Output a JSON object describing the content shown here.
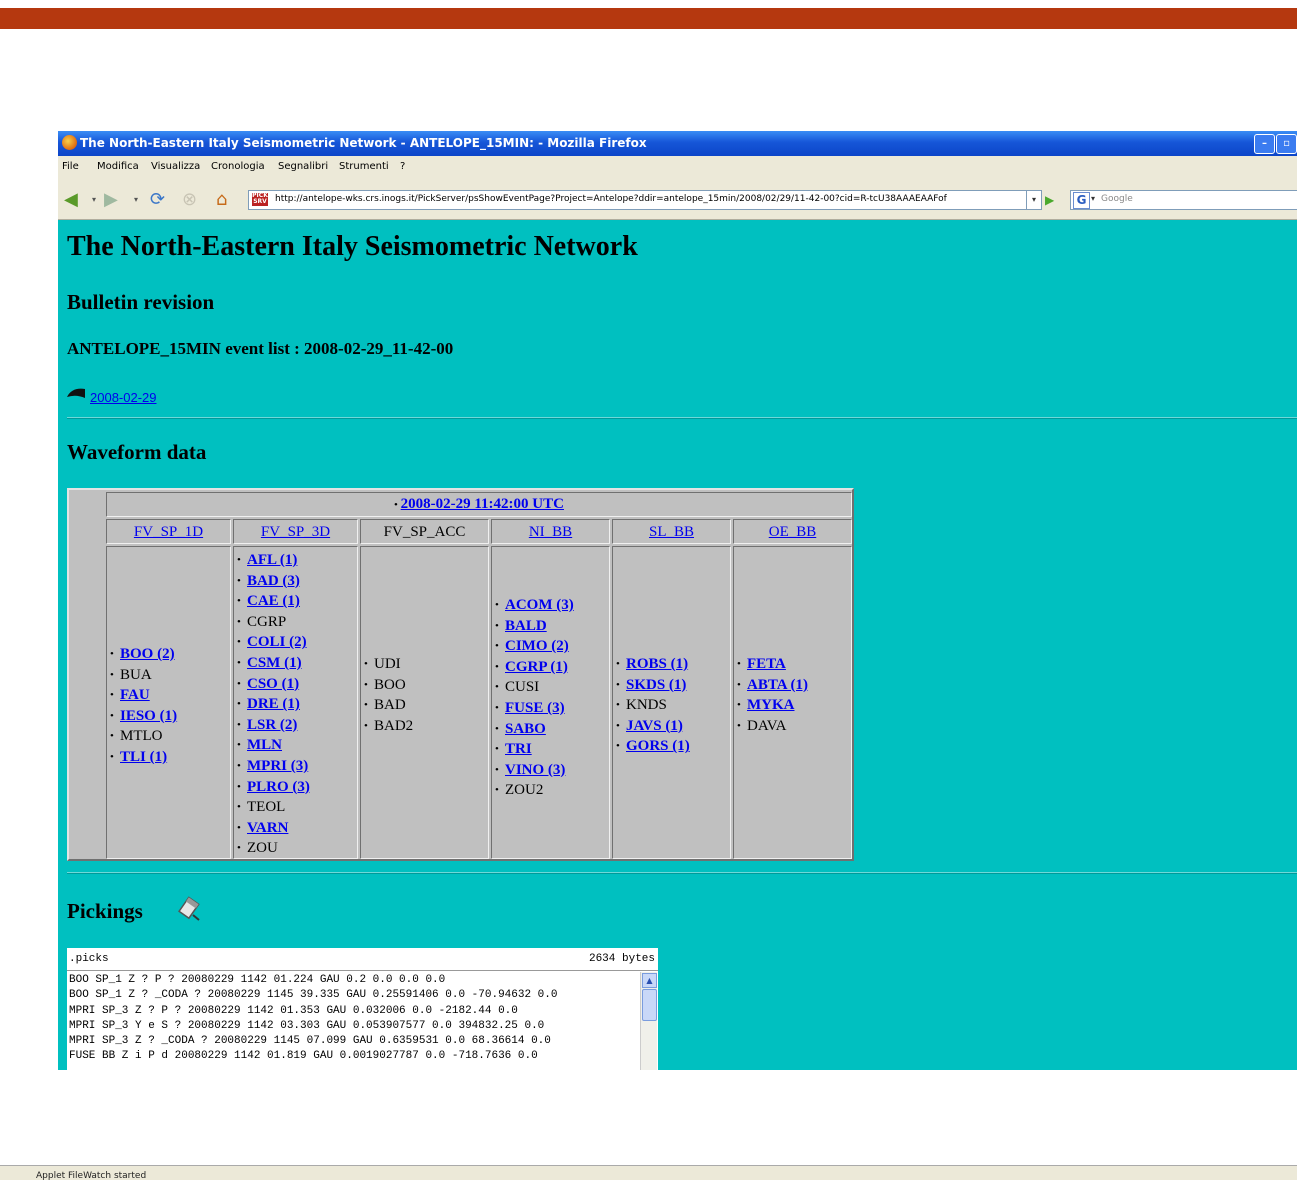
{
  "window": {
    "title": "The North-Eastern Italy Seismometric Network - ANTELOPE_15MIN: - Mozilla Firefox",
    "minimize": "–",
    "maximize": "▫"
  },
  "menu": [
    "File",
    "Modifica",
    "Visualizza",
    "Cronologia",
    "Segnalibri",
    "Strumenti",
    "?"
  ],
  "toolbar": {
    "url": "http://antelope-wks.crs.inogs.it/PickServer/psShowEventPage?Project=Antelope?ddir=antelope_15min/2008/02/29/11-42-00?cid=R-tcU38AAAEAAFof",
    "search_placeholder": "Google"
  },
  "page": {
    "title": "The North-Eastern Italy Seismometric Network",
    "subtitle": "Bulletin revision",
    "event_list": "ANTELOPE_15MIN event list : 2008-02-29_11-42-00",
    "back_link": "2008-02-29",
    "waveform_heading": "Waveform data",
    "pickings_heading": "Pickings"
  },
  "waveform": {
    "timestamp": "2008-02-29 11:42:00 UTC",
    "columns": [
      {
        "name": "FV_SP_1D",
        "link": true,
        "stations": [
          {
            "label": "BOO (2)",
            "link": true
          },
          {
            "label": "BUA",
            "link": false
          },
          {
            "label": "FAU",
            "link": true
          },
          {
            "label": "IESO (1)",
            "link": true
          },
          {
            "label": "MTLO",
            "link": false
          },
          {
            "label": "TLI (1)",
            "link": true
          }
        ]
      },
      {
        "name": "FV_SP_3D",
        "link": true,
        "stations": [
          {
            "label": "AFL (1)",
            "link": true
          },
          {
            "label": "BAD (3)",
            "link": true
          },
          {
            "label": "CAE (1)",
            "link": true
          },
          {
            "label": "CGRP",
            "link": false
          },
          {
            "label": "COLI (2)",
            "link": true
          },
          {
            "label": "CSM (1)",
            "link": true
          },
          {
            "label": "CSO (1)",
            "link": true
          },
          {
            "label": "DRE (1)",
            "link": true
          },
          {
            "label": "LSR (2)",
            "link": true
          },
          {
            "label": "MLN",
            "link": true
          },
          {
            "label": "MPRI (3)",
            "link": true
          },
          {
            "label": "PLRO (3)",
            "link": true
          },
          {
            "label": "TEOL",
            "link": false
          },
          {
            "label": "VARN",
            "link": true
          },
          {
            "label": "ZOU",
            "link": false
          }
        ]
      },
      {
        "name": "FV_SP_ACC",
        "link": false,
        "stations": [
          {
            "label": "UDI",
            "link": false
          },
          {
            "label": "BOO",
            "link": false
          },
          {
            "label": "BAD",
            "link": false
          },
          {
            "label": "BAD2",
            "link": false
          }
        ]
      },
      {
        "name": "NI_BB",
        "link": true,
        "stations": [
          {
            "label": "ACOM (3)",
            "link": true
          },
          {
            "label": "BALD",
            "link": true
          },
          {
            "label": "CIMO (2)",
            "link": true
          },
          {
            "label": "CGRP (1)",
            "link": true
          },
          {
            "label": "CUSI",
            "link": false
          },
          {
            "label": "FUSE (3)",
            "link": true
          },
          {
            "label": "SABO",
            "link": true
          },
          {
            "label": "TRI",
            "link": true
          },
          {
            "label": "VINO (3)",
            "link": true
          },
          {
            "label": "ZOU2",
            "link": false
          }
        ]
      },
      {
        "name": "SL_BB",
        "link": true,
        "stations": [
          {
            "label": "ROBS (1)",
            "link": true
          },
          {
            "label": "SKDS (1)",
            "link": true
          },
          {
            "label": "KNDS",
            "link": false
          },
          {
            "label": "JAVS (1)",
            "link": true
          },
          {
            "label": "GORS (1)",
            "link": true
          }
        ]
      },
      {
        "name": "OE_BB",
        "link": true,
        "stations": [
          {
            "label": "FETA",
            "link": true
          },
          {
            "label": "ABTA (1)",
            "link": true
          },
          {
            "label": "MYKA",
            "link": true
          },
          {
            "label": "DAVA",
            "link": false
          }
        ]
      }
    ]
  },
  "picks": {
    "filename": ".picks",
    "size": "2634 bytes",
    "lines": [
      "BOO SP_1 Z ? P ? 20080229 1142 01.224 GAU 0.2 0.0 0.0 0.0",
      "BOO SP_1 Z ? _CODA ? 20080229 1145 39.335 GAU 0.25591406 0.0 -70.94632 0.0",
      "MPRI SP_3 Z ? P ? 20080229 1142 01.353 GAU 0.032006 0.0 -2182.44 0.0",
      "MPRI SP_3 Y e S ? 20080229 1142 03.303 GAU 0.053907577 0.0 394832.25 0.0",
      "MPRI SP_3 Z ? _CODA ? 20080229 1145 07.099 GAU 0.6359531 0.0 68.36614 0.0",
      "FUSE BB Z i P d 20080229 1142 01.819 GAU 0.0019027787 0.0 -718.7636 0.0"
    ]
  },
  "status": "Applet FileWatch started"
}
